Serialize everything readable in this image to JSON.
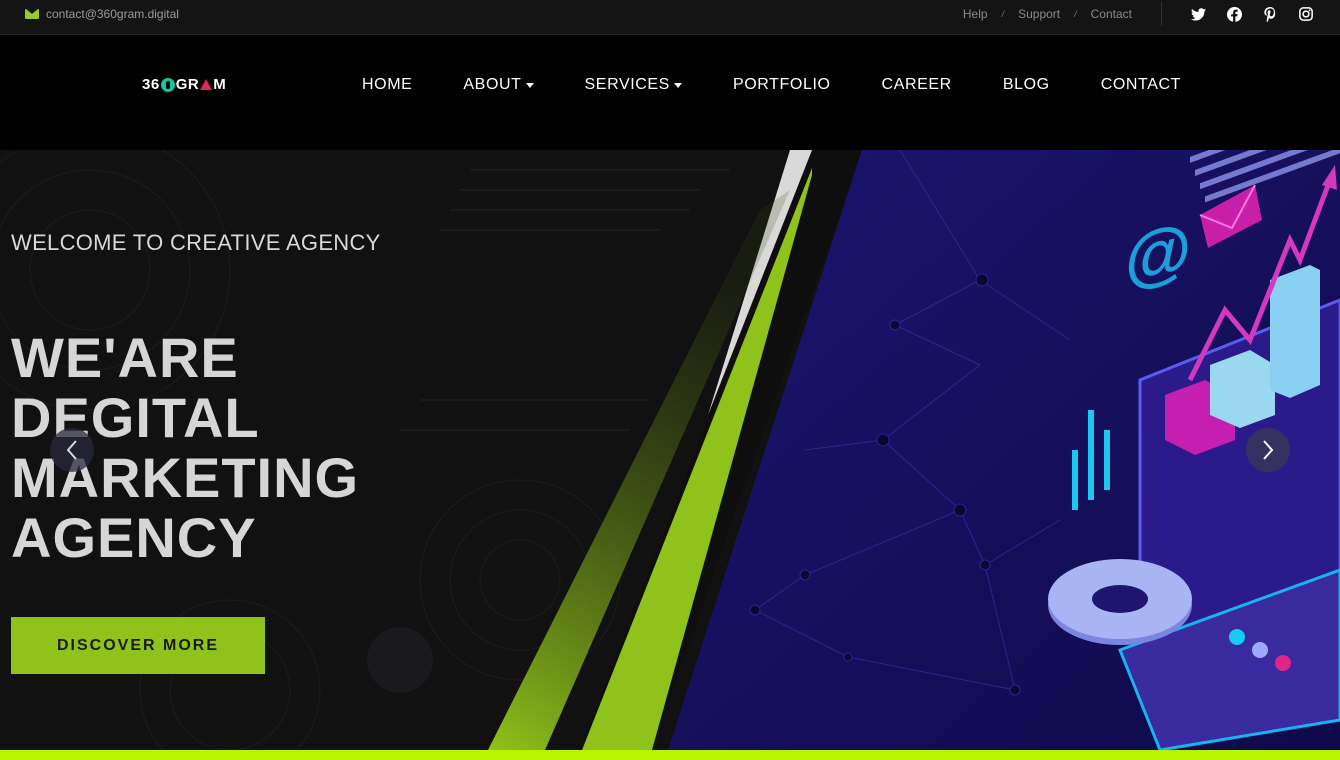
{
  "topbar": {
    "email": "contact@360gram.digital",
    "links": [
      "Help",
      "Support",
      "Contact"
    ],
    "separator": "/",
    "social": [
      "twitter-icon",
      "facebook-icon",
      "pinterest-icon",
      "instagram-icon"
    ]
  },
  "brand": {
    "logo_parts": [
      "36",
      "GR",
      "M"
    ]
  },
  "nav": {
    "items": [
      {
        "label": "HOME",
        "dropdown": false
      },
      {
        "label": "ABOUT",
        "dropdown": true
      },
      {
        "label": "SERVICES",
        "dropdown": true
      },
      {
        "label": "PORTFOLIO",
        "dropdown": false
      },
      {
        "label": "CAREER",
        "dropdown": false
      },
      {
        "label": "BLOG",
        "dropdown": false
      },
      {
        "label": "CONTACT",
        "dropdown": false
      }
    ]
  },
  "hero": {
    "welcome": "WELCOME TO CREATIVE AGENCY",
    "headline": [
      "WE'ARE",
      "DEGITAL",
      "MARKETING",
      "AGENCY"
    ],
    "cta": "DISCOVER MORE"
  },
  "colors": {
    "accent": "#8fc21b",
    "bottom_bar": "#b6f400",
    "hero_right": "#1a1266"
  }
}
